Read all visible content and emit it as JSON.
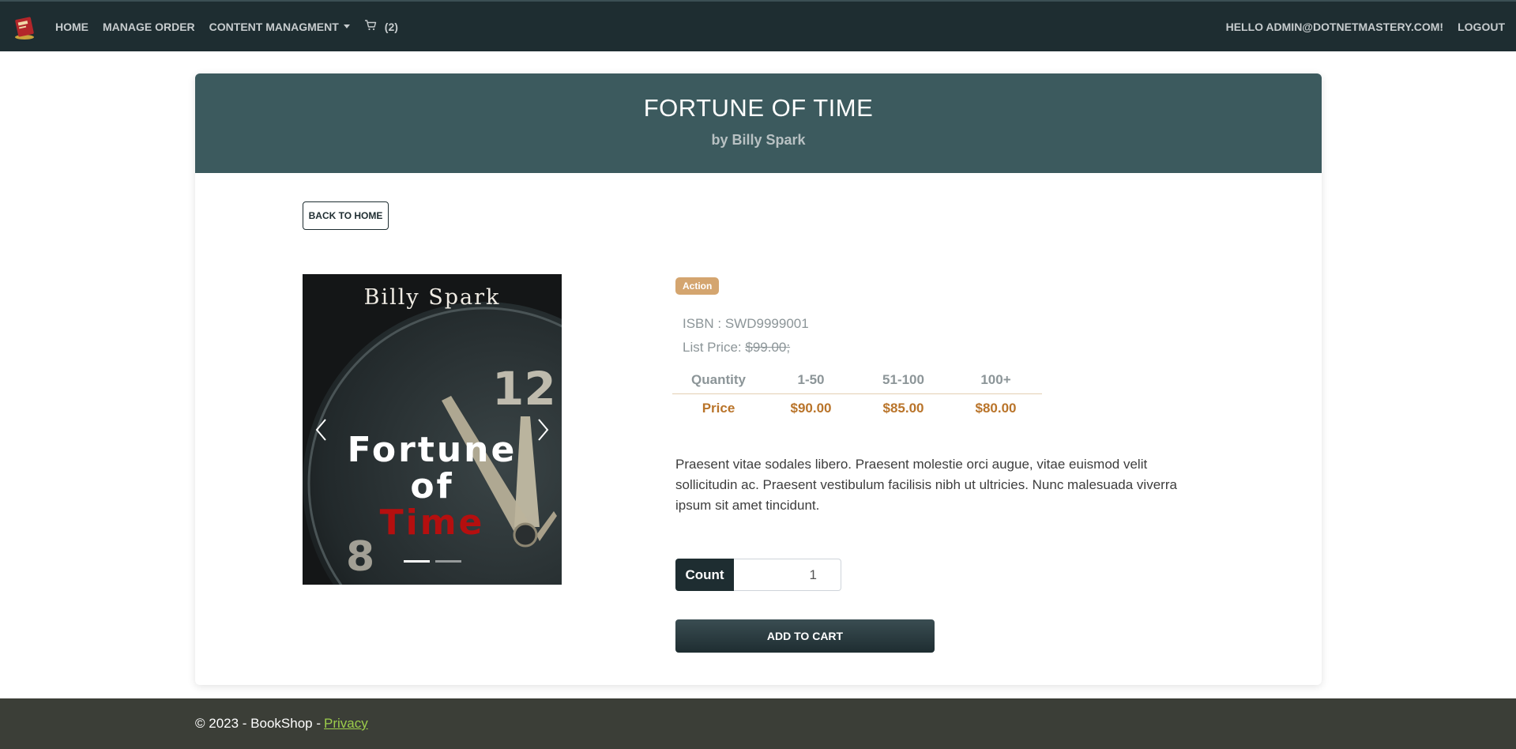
{
  "nav": {
    "home": "HOME",
    "manage_order": "MANAGE ORDER",
    "content_management": "CONTENT MANAGMENT",
    "cart_count": "(2)",
    "greeting": "HELLO ADMIN@DOTNETMASTERY.COM!",
    "logout": "LOGOUT"
  },
  "header": {
    "title": "FORTUNE OF TIME",
    "author": "by Billy Spark"
  },
  "back_button": "BACK TO HOME",
  "cover": {
    "author": "Billy Spark",
    "title_line1": "Fortune",
    "title_line2": "of",
    "title_line3": "Time"
  },
  "details": {
    "category": "Action",
    "isbn": "ISBN : SWD9999001",
    "list_price_label": "List Price: ",
    "list_price_value": "$99.00;"
  },
  "price_table": {
    "headers": [
      "Quantity",
      "1-50",
      "51-100",
      "100+"
    ],
    "prices": [
      "Price",
      "$90.00",
      "$85.00",
      "$80.00"
    ]
  },
  "description": "Praesent vitae sodales libero. Praesent molestie orci augue, vitae euismod velit sollicitudin ac. Praesent vestibulum facilisis nibh ut ultricies. Nunc malesuada viverra ipsum sit amet tincidunt.",
  "count": {
    "label": "Count",
    "value": "1"
  },
  "add_to_cart": "ADD TO CART",
  "footer": {
    "text": "© 2023 - BookShop -",
    "privacy": "Privacy"
  },
  "colors": {
    "navbar": "#1e2d31",
    "header": "#3c5a5e",
    "badge": "#d4a56f",
    "price_accent": "#b9742a",
    "footer": "#3b3e37",
    "link": "#9ccd4b"
  }
}
